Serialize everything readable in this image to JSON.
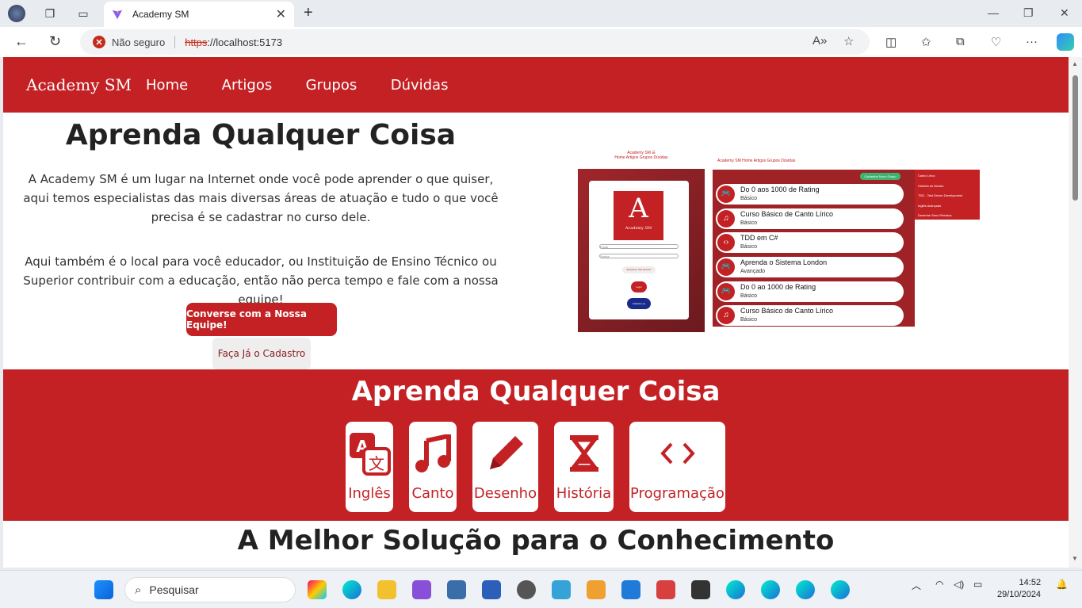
{
  "browser": {
    "tab_title": "Academy SM",
    "security_label": "Não seguro",
    "url_scheme": "https",
    "url_rest": "://localhost:5173"
  },
  "site": {
    "brand": "Academy SM",
    "menu": [
      "Home",
      "Artigos",
      "Grupos",
      "Dúvidas"
    ]
  },
  "hero": {
    "title": "Aprenda Qualquer Coisa",
    "paragraph1": "A Academy SM é um lugar na Internet onde você pode aprender o que quiser, aqui temos especialistas das mais diversas áreas de atuação e tudo o que você precisa é se cadastrar no curso dele.",
    "paragraph2": "Aqui também é o local para você educador, ou Instituição de Ensino Técnico ou Superior contribuir com a educação, então não perca tempo e fale com a nossa equipe!",
    "cta_primary": "Converse com a Nossa Equipe!",
    "cta_secondary": "Faça Já o Cadastro"
  },
  "preview_login": {
    "header": "Academy SM ☰",
    "nav": "Home   Artigos   Grupos   Dúvidas",
    "logo_letter": "A",
    "logo_text": "Academy SM",
    "field1": "Email",
    "field2": "Senha",
    "forgot": "Esqueceu Sua Senha?",
    "login": "Login",
    "register": "Cadastre-se"
  },
  "preview_groups": {
    "header": "Academy SM   Home   Artigos   Grupos   Dúvidas",
    "new_button": "Cadastrar Novo Grupo",
    "side": [
      "Canto Lírico",
      "História do Mundo",
      "TDD - Test Driven Development",
      "Inglês Avançado",
      "Desenhe Seus Retratos"
    ],
    "items": [
      {
        "name": "Do 0 aos 1000 de Rating",
        "level": "Básico",
        "icon": "gamepad-icon"
      },
      {
        "name": "Curso Básico de Canto Lírico",
        "level": "Básico",
        "icon": "music-icon"
      },
      {
        "name": "TDD em C#",
        "level": "Básico",
        "icon": "code-icon"
      },
      {
        "name": "Aprenda o Sistema London",
        "level": "Avançado",
        "icon": "gamepad-icon"
      },
      {
        "name": "Do 0 ao 1000 de Rating",
        "level": "Básico",
        "icon": "gamepad-icon"
      },
      {
        "name": "Curso Básico de Canto Lírico",
        "level": "Básico",
        "icon": "music-icon"
      }
    ]
  },
  "band": {
    "title": "Aprenda Qualquer Coisa",
    "categories": [
      {
        "label": "Inglês",
        "icon": "translate-icon"
      },
      {
        "label": "Canto",
        "icon": "music-icon"
      },
      {
        "label": "Desenho",
        "icon": "pencil-icon"
      },
      {
        "label": "História",
        "icon": "hourglass-icon"
      },
      {
        "label": "Programação",
        "icon": "code-icon"
      }
    ]
  },
  "section2_title": "A Melhor Solução para o Conhecimento",
  "taskbar": {
    "search_placeholder": "Pesquisar",
    "time": "14:52",
    "date": "29/10/2024"
  },
  "colors": {
    "brand_red": "#c42125",
    "link_blue": "#1a2a8a"
  }
}
